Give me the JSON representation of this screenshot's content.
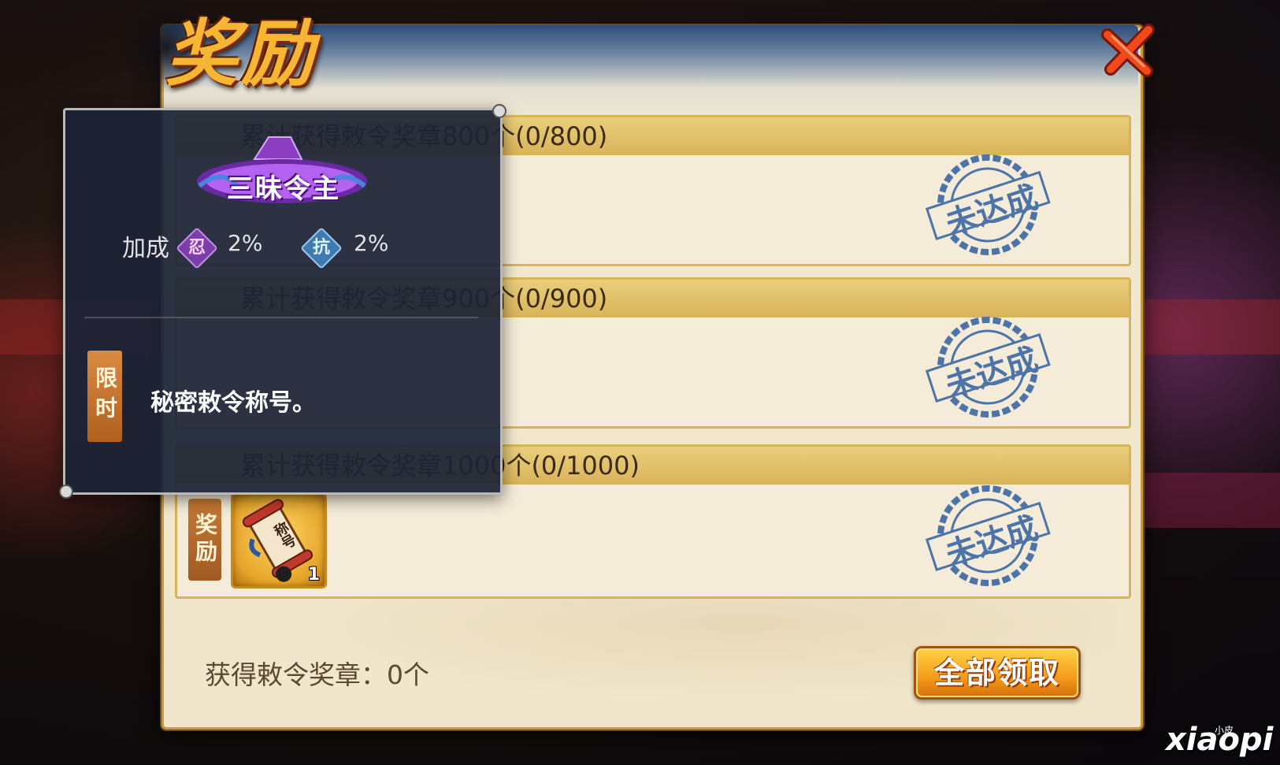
{
  "header": {
    "title": "奖励"
  },
  "tasks": [
    {
      "label": "累计获得敕令奖章800个(0/800)",
      "status": "未达成"
    },
    {
      "label": "累计获得敕令奖章900个(0/900)",
      "status": "未达成"
    },
    {
      "label": "累计获得敕令奖章1000个(0/1000)",
      "status": "未达成",
      "reward_tag": "奖励",
      "reward_item": {
        "text": "称号",
        "quantity": "1",
        "icon": "title-scroll-icon"
      }
    }
  ],
  "footer": {
    "medal_count_label": "获得敕令奖章：0个",
    "claim_all_button": "全部领取"
  },
  "tooltip": {
    "title_name": "三昧令主",
    "bonus_label": "加成",
    "bonuses": [
      {
        "icon_text": "忍",
        "value": "2%",
        "color": "#7a3fa8"
      },
      {
        "icon_text": "抗",
        "value": "2%",
        "color": "#3f7ab0"
      }
    ],
    "limit_tag": "限时",
    "description": "秘密敕令称号。"
  },
  "watermark": {
    "text": "xiaopi",
    "small": "小皮"
  },
  "colors": {
    "accent_gold": "#f7b534",
    "stamp_blue": "#4d74a8",
    "button_orange": "#f59a1a"
  }
}
